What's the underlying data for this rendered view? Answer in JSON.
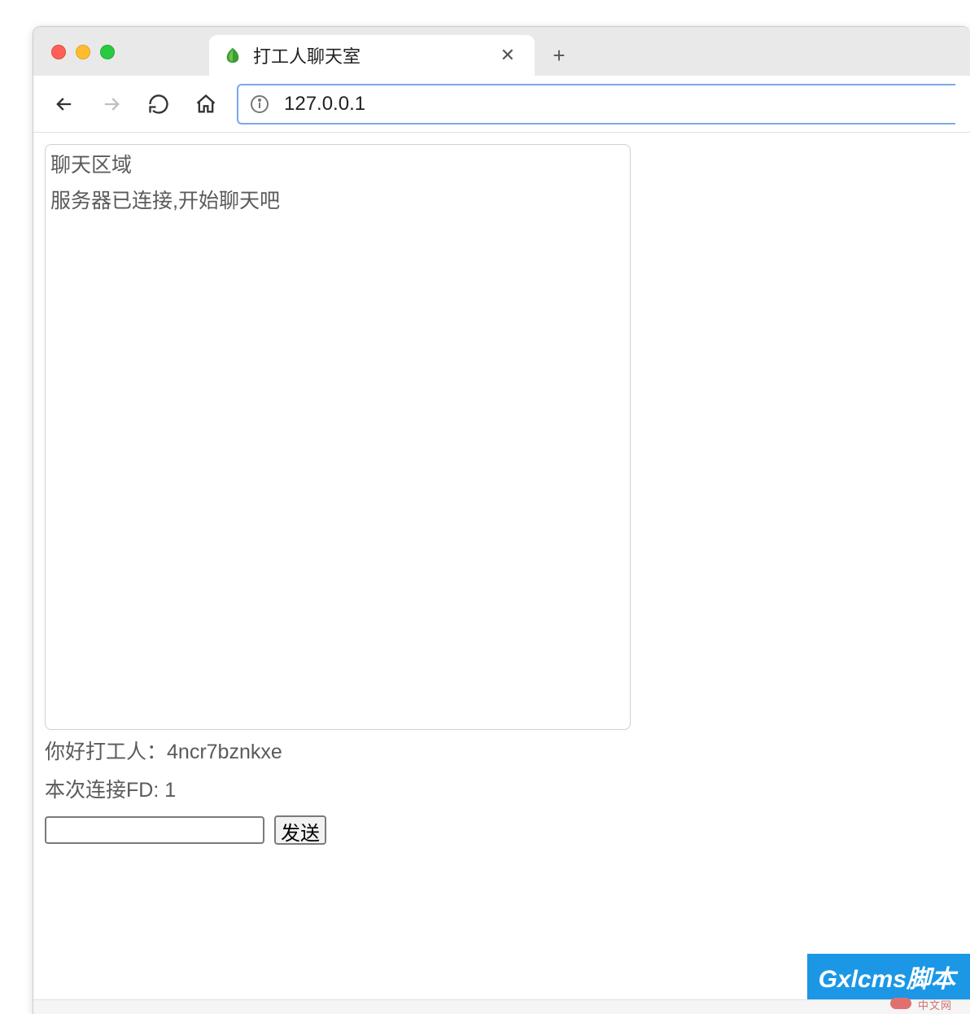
{
  "browser": {
    "tab": {
      "title": "打工人聊天室",
      "favicon": "leaf-icon"
    },
    "address": "127.0.0.1"
  },
  "chat": {
    "header": "聊天区域",
    "messages": [
      "服务器已连接,开始聊天吧"
    ]
  },
  "user": {
    "greeting_label": "你好打工人：",
    "username": "4ncr7bznkxe",
    "fd_label": "本次连接FD: ",
    "fd_value": "1"
  },
  "input": {
    "value": "",
    "send_label": "发送"
  },
  "watermark": {
    "main": "Gxlcms脚本",
    "sub": "中文网"
  }
}
